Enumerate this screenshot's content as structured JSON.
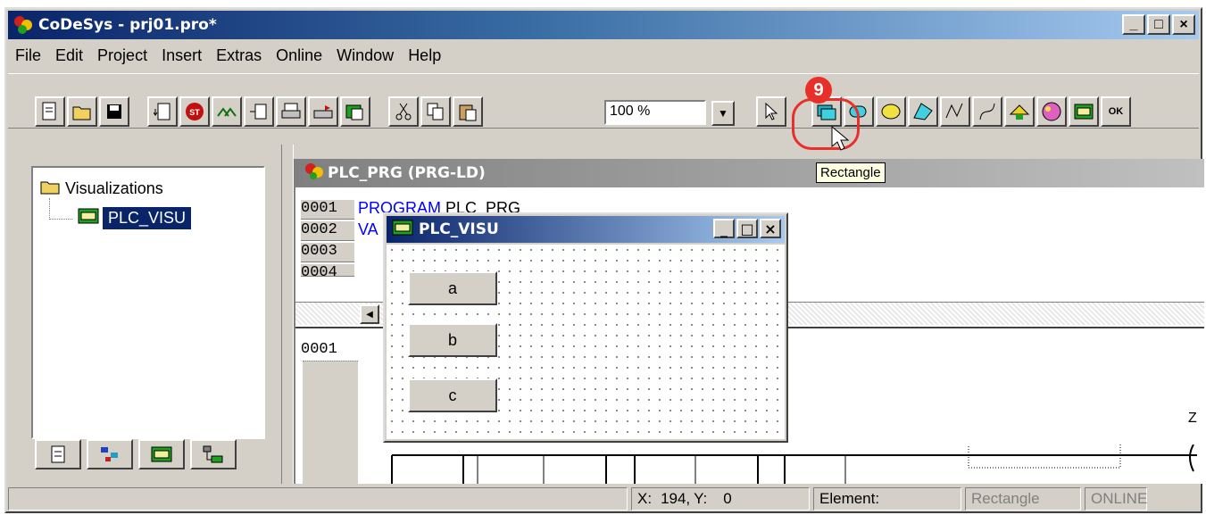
{
  "app": {
    "title": "CoDeSys - prj01.pro*"
  },
  "window_buttons": [
    "_",
    "□",
    "×"
  ],
  "menu": [
    "File",
    "Edit",
    "Project",
    "Insert",
    "Extras",
    "Online",
    "Window",
    "Help"
  ],
  "toolbar": {
    "zoom_value": "100 %",
    "callout_number": "9",
    "tooltip": "Rectangle",
    "ok_label": "OK"
  },
  "tree": {
    "root_label": "Visualizations",
    "child_label": "PLC_VISU"
  },
  "editor": {
    "title": "PLC_PRG (PRG-LD)",
    "lines": [
      {
        "no": "0001",
        "kw": "PROGRAM",
        "text": " PLC_PRG"
      },
      {
        "no": "0002",
        "kw": "VA",
        "text": ""
      },
      {
        "no": "0003",
        "kw": "",
        "text": ""
      },
      {
        "no": "0004",
        "kw": "",
        "text": ""
      }
    ],
    "network_no": "0001",
    "coil_label": "Z"
  },
  "visu": {
    "title": "PLC_VISU",
    "buttons": [
      "a",
      "b",
      "c"
    ]
  },
  "status": {
    "x_label": "X:",
    "x_value": "194,",
    "y_label": "Y:",
    "y_value": "0",
    "element_label": "Element:",
    "element_type": "Rectangle",
    "online": "ONLINE"
  }
}
